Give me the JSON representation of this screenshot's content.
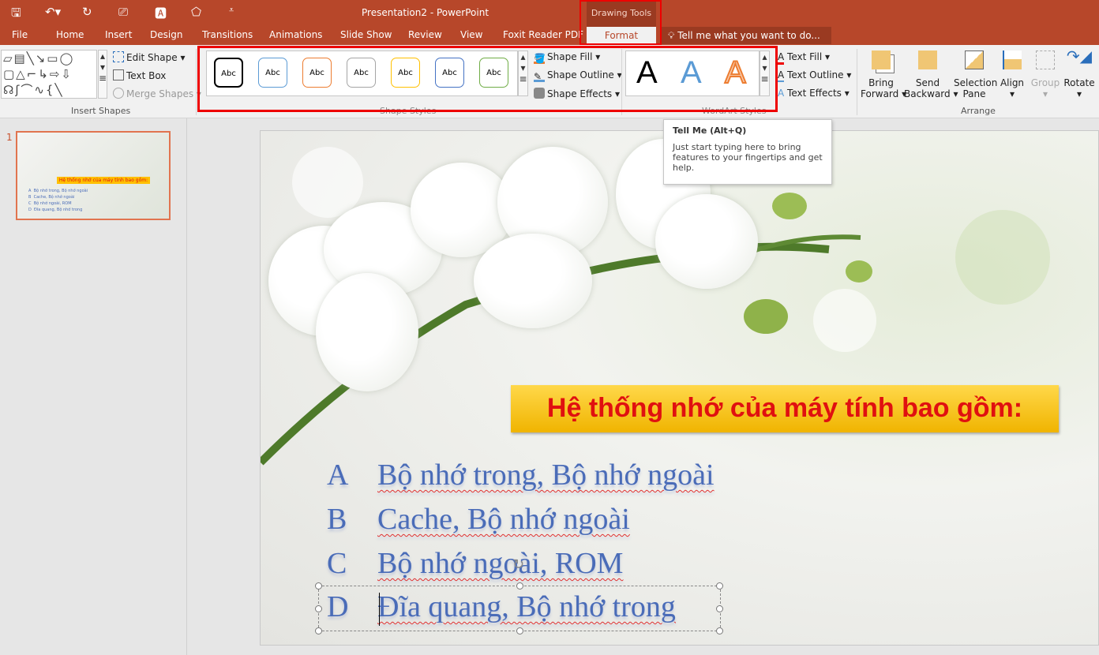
{
  "app": {
    "title": "Presentation2 - PowerPoint",
    "contextual_group": "Drawing Tools"
  },
  "quick_access": [
    "save-icon",
    "undo-icon",
    "redo-icon",
    "present-icon",
    "wordart-icon",
    "shape-icon",
    "customize-icon"
  ],
  "tabs": [
    "File",
    "Home",
    "Insert",
    "Design",
    "Transitions",
    "Animations",
    "Slide Show",
    "Review",
    "View",
    "Foxit Reader PDF",
    "Format"
  ],
  "active_tab": "Format",
  "tell_me": {
    "placeholder": "Tell me what you want to do..."
  },
  "ribbon": {
    "insert_shapes": {
      "label": "Insert Shapes",
      "edit_shape": "Edit Shape",
      "text_box": "Text Box",
      "merge_shapes": "Merge Shapes"
    },
    "shape_styles": {
      "label": "Shape Styles",
      "preset_text": "Abc",
      "preset_colors": [
        "#000000",
        "#5b9bd5",
        "#ed7d31",
        "#a5a5a5",
        "#ffc000",
        "#4472c4",
        "#70ad47"
      ],
      "shape_fill": "Shape Fill",
      "shape_outline": "Shape Outline",
      "shape_effects": "Shape Effects"
    },
    "wordart_styles": {
      "label": "WordArt Styles",
      "sample": "A",
      "text_fill": "Text Fill",
      "text_outline": "Text Outline",
      "text_effects": "Text Effects"
    },
    "arrange": {
      "label": "Arrange",
      "bring_forward": [
        "Bring",
        "Forward"
      ],
      "send_backward": [
        "Send",
        "Backward"
      ],
      "selection_pane": [
        "Selection",
        "Pane"
      ],
      "align": "Align",
      "group": "Group",
      "rotate": "Rotate"
    }
  },
  "tooltip": {
    "title": "Tell Me (Alt+Q)",
    "body": "Just start typing here to bring features to your fingertips and get help."
  },
  "thumbnail": {
    "number": "1"
  },
  "slide": {
    "title": "Hệ thống nhớ của máy tính bao gồm:",
    "options": [
      {
        "letter": "A",
        "text": "Bộ nhớ trong, Bộ nhớ ngoài"
      },
      {
        "letter": "B",
        "text": "Cache, Bộ nhớ ngoài"
      },
      {
        "letter": "C",
        "text": "Bộ nhớ ngoài, ROM"
      },
      {
        "letter": "D",
        "text": "Đĩa quang, Bộ nhớ trong"
      }
    ]
  },
  "colors": {
    "accent": "#b7472a",
    "highlight_box": "#ee0000",
    "title_fill": "#ffc000",
    "title_text": "#e01010",
    "option_text": "#4a6cb8"
  }
}
